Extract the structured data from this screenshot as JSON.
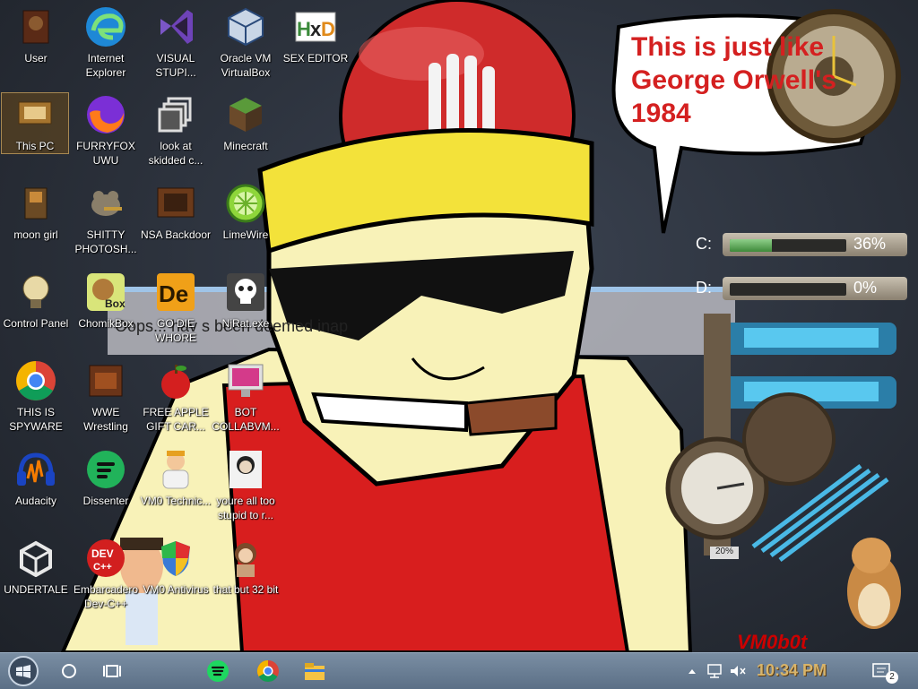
{
  "desktop": {
    "icons": [
      {
        "label": "User",
        "icon": "user-folder-icon"
      },
      {
        "label": "Internet Explorer",
        "icon": "edge-browser-icon"
      },
      {
        "label": "VISUAL STUPI...",
        "icon": "visual-studio-icon"
      },
      {
        "label": "Oracle VM VirtualBox",
        "icon": "virtualbox-icon"
      },
      {
        "label": "SEX EDITOR",
        "icon": "hex-editor-icon"
      },
      {
        "label": "This PC",
        "icon": "this-pc-icon"
      },
      {
        "label": "FURRYFOX UWU",
        "icon": "firefox-icon"
      },
      {
        "label": "look at skidded c...",
        "icon": "copy-windows-icon"
      },
      {
        "label": "Minecraft",
        "icon": "minecraft-grass-block-icon"
      },
      {
        "label": "moon girl",
        "icon": "wooden-box-icon"
      },
      {
        "label": "SHITTY PHOTOSH...",
        "icon": "gimp-icon"
      },
      {
        "label": "NSA Backdoor",
        "icon": "steampunk-frame-icon"
      },
      {
        "label": "LimeWire",
        "icon": "limewire-icon"
      },
      {
        "label": "Control Panel",
        "icon": "lightbulb-icon"
      },
      {
        "label": "ChomikBox",
        "icon": "chomikbox-hamster-icon"
      },
      {
        "label": "GO DIE WHORE",
        "icon": "de-app-icon"
      },
      {
        "label": "NjRat.exe",
        "icon": "skull-icon"
      },
      {
        "label": "THIS IS SPYWARE",
        "icon": "chrome-icon"
      },
      {
        "label": "WWE Wrestling",
        "icon": "oven-icon"
      },
      {
        "label": "FREE APPLE GIFT CAR...",
        "icon": "apple-fruit-icon"
      },
      {
        "label": "BOT COLLABVM...",
        "icon": "monitor-icon"
      },
      {
        "label": "Audacity",
        "icon": "audacity-icon"
      },
      {
        "label": "Dissenter",
        "icon": "dissenter-icon"
      },
      {
        "label": "VM0 Technic...",
        "icon": "technician-icon"
      },
      {
        "label": "youre all too stupid to r...",
        "icon": "portrait-icon"
      },
      {
        "label": "UNDERTALE",
        "icon": "unity-icon"
      },
      {
        "label": "Embarcadero Dev-C++",
        "icon": "devcpp-icon"
      },
      {
        "label": "VM0 Antivirus",
        "icon": "shield-icon"
      },
      {
        "label": "that but 32 bit",
        "icon": "portrait-lady-icon"
      }
    ],
    "speech_bubble": "This is just like George Orwell's 1984",
    "blocked_message": "Oops... hav    s been deemed inap",
    "drives": [
      {
        "letter": "C:",
        "percent": "36%",
        "fill": 0.36
      },
      {
        "letter": "D:",
        "percent": "0%",
        "fill": 0.0
      }
    ],
    "gauge_label": "20%",
    "watermark": "VM0b0t"
  },
  "taskbar": {
    "start": "start-orb-icon",
    "search": "search-circle-icon",
    "task_view": "task-view-icon",
    "pinned": [
      "spotify-icon",
      "chrome-icon",
      "file-explorer-icon"
    ],
    "clock": "10:34 PM",
    "notification_count": "2"
  },
  "colors": {
    "taskbar": "#6a7f96",
    "accent_red": "#d42020",
    "clock": "#d8b46a"
  }
}
